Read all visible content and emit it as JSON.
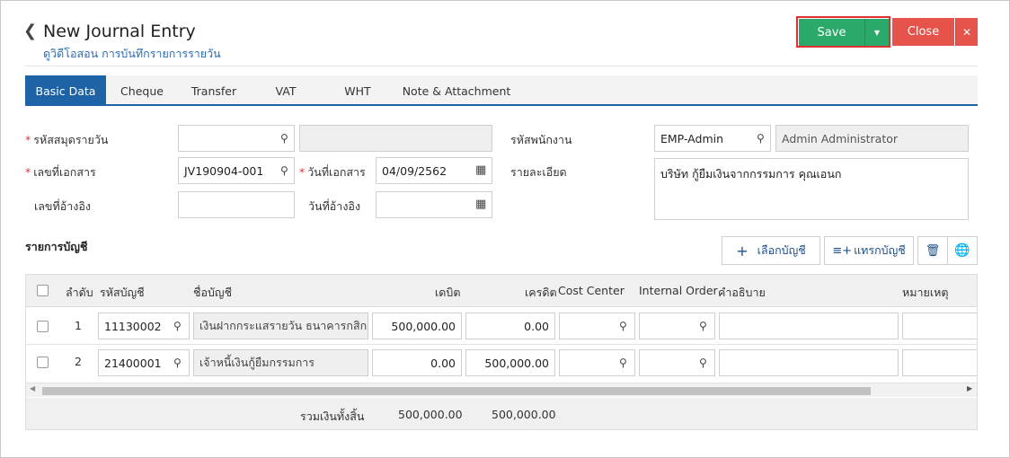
{
  "header": {
    "back_icon": "chevron-left-icon",
    "title": "New Journal Entry",
    "subtitle": "ดูวิดีโอสอน การบันทึกรายการรายวัน",
    "save_label": "Save",
    "close_label": "Close"
  },
  "tabs": [
    {
      "label": "Basic Data",
      "active": true
    },
    {
      "label": "Cheque"
    },
    {
      "label": "Transfer"
    },
    {
      "label": "VAT"
    },
    {
      "label": "WHT"
    },
    {
      "label": "Note & Attachment"
    }
  ],
  "form": {
    "journal_book_label": "รหัสสมุดรายวัน",
    "journal_book_value": "",
    "journal_book_name": "",
    "doc_no_label": "เลขที่เอกสาร",
    "doc_no_value": "JV190904-001",
    "doc_date_label": "วันที่เอกสาร",
    "doc_date_value": "04/09/2562",
    "ref_no_label": "เลขที่อ้างอิง",
    "ref_no_value": "",
    "ref_date_label": "วันที่อ้างอิง",
    "ref_date_value": "",
    "employee_label": "รหัสพนักงาน",
    "employee_code": "EMP-Admin",
    "employee_name": "Admin Administrator",
    "detail_label": "รายละเอียด",
    "detail_value": "บริษัท กู้ยืมเงินจากกรรมการ คุณเอนก"
  },
  "accounts": {
    "section_title": "รายการบัญชี",
    "select_account_label": "เลือกบัญชี",
    "insert_account_label": "แทรกบัญชี",
    "columns": {
      "no": "ลำดับ",
      "code": "รหัสบัญชี",
      "name": "ชื่อบัญชี",
      "debit": "เดบิต",
      "credit": "เครดิต",
      "cost_center": "Cost Center",
      "internal_order": "Internal Order",
      "description": "คำอธิบาย",
      "remark": "หมายเหตุ"
    },
    "rows": [
      {
        "no": "1",
        "code": "11130002",
        "name": "เงินฝากกระแสรายวัน ธนาคารกสิกร",
        "debit": "500,000.00",
        "credit": "0.00"
      },
      {
        "no": "2",
        "code": "21400001",
        "name": "เจ้าหนี้เงินกู้ยืมกรรมการ",
        "debit": "0.00",
        "credit": "500,000.00"
      }
    ],
    "total_label": "รวมเงินทั้งสิ้น",
    "total_debit": "500,000.00",
    "total_credit": "500,000.00"
  }
}
